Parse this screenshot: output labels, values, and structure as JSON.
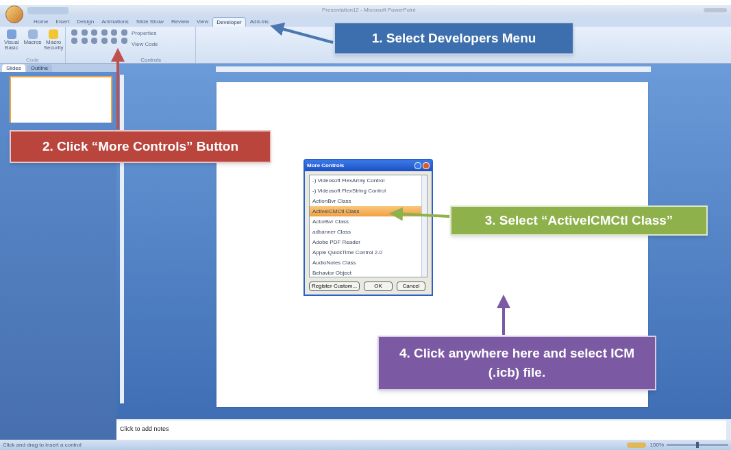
{
  "window": {
    "title": "Presentation12 - Microsoft PowerPoint"
  },
  "ribbon": {
    "tabs": [
      {
        "label": "Home",
        "selected": false
      },
      {
        "label": "Insert",
        "selected": false
      },
      {
        "label": "Design",
        "selected": false
      },
      {
        "label": "Animations",
        "selected": false
      },
      {
        "label": "Slide Show",
        "selected": false
      },
      {
        "label": "Review",
        "selected": false
      },
      {
        "label": "View",
        "selected": false
      },
      {
        "label": "Developer",
        "selected": true
      },
      {
        "label": "Add-Ins",
        "selected": false
      }
    ],
    "code_group": {
      "label": "Code",
      "buttons": [
        "Visual Basic",
        "Macros",
        "Macro Security"
      ]
    },
    "controls_group": {
      "label": "Controls",
      "buttons": [
        "Properties",
        "View Code"
      ]
    }
  },
  "slides_pane": {
    "tabs": [
      {
        "label": "Slides",
        "selected": true
      },
      {
        "label": "Outline",
        "selected": false
      }
    ]
  },
  "dialog": {
    "title": "More Controls",
    "items": [
      {
        "label": "-) Videosoft FlexArray Control",
        "selected": false
      },
      {
        "label": "-) Videosoft FlexString Control",
        "selected": false
      },
      {
        "label": "ActionBvr Class",
        "selected": false
      },
      {
        "label": "ActiveICMCtl Class",
        "selected": true
      },
      {
        "label": "ActorBvr Class",
        "selected": false
      },
      {
        "label": "adbanner Class",
        "selected": false
      },
      {
        "label": "Adobe PDF Reader",
        "selected": false
      },
      {
        "label": "Apple QuickTime Control 2.0",
        "selected": false
      },
      {
        "label": "AudioNotes Class",
        "selected": false
      },
      {
        "label": "Behavior Object",
        "selected": false
      }
    ],
    "buttons": [
      "Register Custom...",
      "OK",
      "Cancel"
    ]
  },
  "notes": {
    "placeholder": "Click to add notes"
  },
  "status_bar": {
    "text": "Click and drag to insert a control",
    "zoom": "100%",
    "zoom_slider": {
      "level": 0.5
    }
  },
  "callouts": [
    {
      "text": "1. Select Developers Menu",
      "color": "#3d6fae"
    },
    {
      "text": "2. Click “More Controls” Button",
      "color": "#b9453d"
    },
    {
      "text": "3. Select “ActiveICMCtl Class”",
      "color": "#8eb14c"
    },
    {
      "text": "4. Click anywhere here and select ICM (.icb) file.",
      "color": "#7b5aa3"
    }
  ]
}
